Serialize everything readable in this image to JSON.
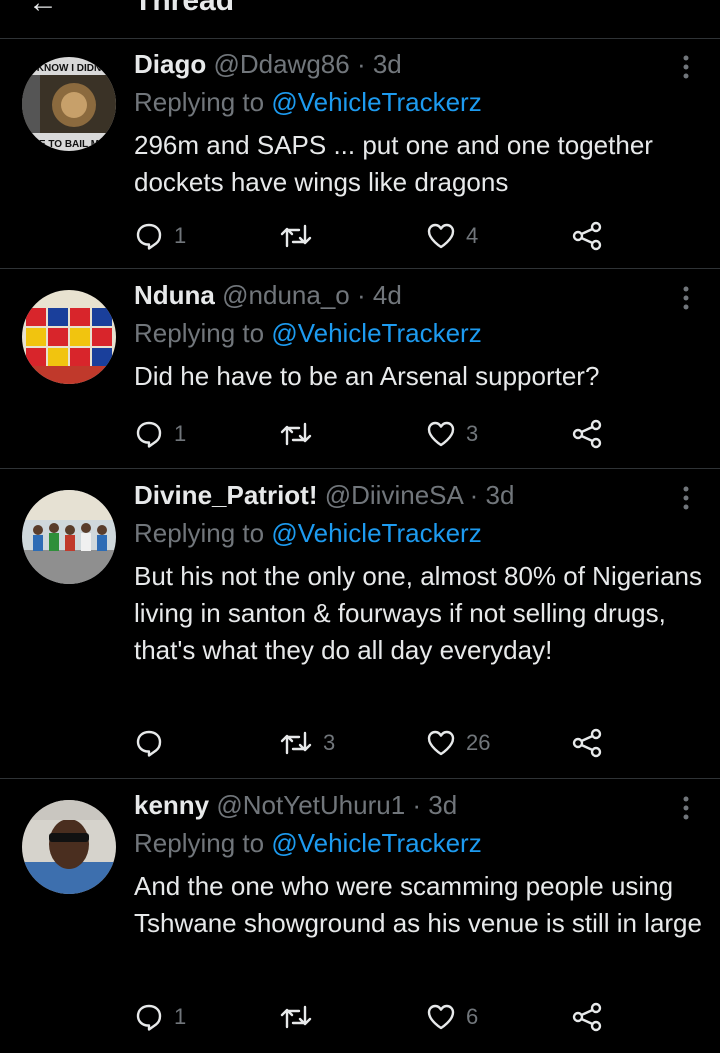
{
  "header": {
    "back_icon": "back-arrow-icon",
    "title": "Thread"
  },
  "replying_to_label": "Replying to",
  "tweets": [
    {
      "name": "Diago",
      "handle": "@Ddawg86",
      "time": "3d",
      "mention": "@VehicleTrackerz",
      "text": "296m and SAPS ... put one and one together dockets have wings like dragons",
      "replies": "1",
      "retweets": "",
      "likes": "4",
      "avatar_text_top": "KNOW I DIDN",
      "avatar_text_bottom": "VE TO BAIL MY"
    },
    {
      "name": "Nduna",
      "handle": "@nduna_o",
      "time": "4d",
      "mention": "@VehicleTrackerz",
      "text": "Did he have to be an Arsenal supporter?",
      "replies": "1",
      "retweets": "",
      "likes": "3"
    },
    {
      "name": "Divine_Patriot!",
      "handle": "@DiivineSA",
      "time": "3d",
      "mention": "@VehicleTrackerz",
      "text": "But his not the only one, almost 80% of Nigerians living in santon & fourways if not selling drugs, that's what they do all day everyday!",
      "replies": "",
      "retweets": "3",
      "likes": "26"
    },
    {
      "name": "kenny",
      "handle": "@NotYetUhuru1",
      "time": "3d",
      "mention": "@VehicleTrackerz",
      "text": "And the one who were scamming people using Tshwane showground as his venue is still in large",
      "replies": "1",
      "retweets": "",
      "likes": "6"
    }
  ],
  "colors": {
    "background": "#000000",
    "text": "#e7e9ea",
    "secondary": "#71767b",
    "accent": "#1d9bf0",
    "divider": "#2f3336"
  }
}
